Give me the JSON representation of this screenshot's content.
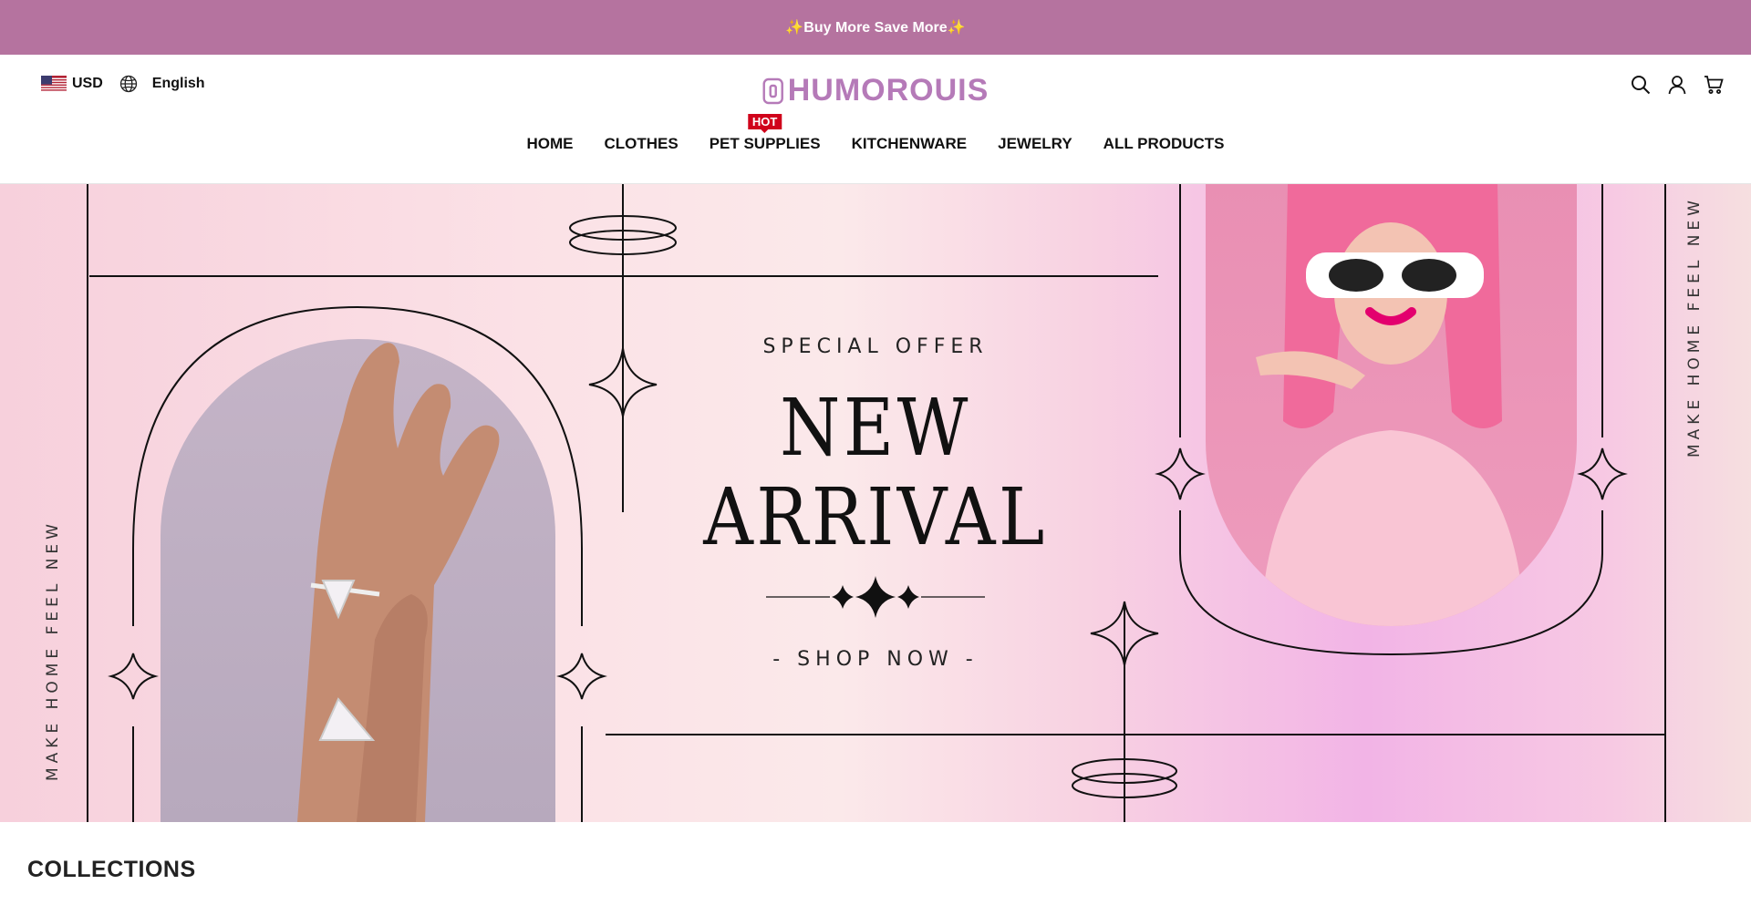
{
  "announcement": {
    "text": "✨Buy More Save More✨"
  },
  "header": {
    "currency": "USD",
    "language": "English",
    "logo": "HUMOROUIS",
    "icons": [
      "search-icon",
      "user-icon",
      "cart-icon"
    ]
  },
  "nav": {
    "items": [
      {
        "label": "HOME"
      },
      {
        "label": "CLOTHES"
      },
      {
        "label": "PET SUPPLIES",
        "badge": "HOT"
      },
      {
        "label": "KITCHENWARE"
      },
      {
        "label": "JEWELRY"
      },
      {
        "label": "ALL PRODUCTS"
      }
    ]
  },
  "hero": {
    "subtitle": "SPECIAL OFFER",
    "title_line1": "NEW",
    "title_line2": "ARRIVAL",
    "cta": "- SHOP NOW -",
    "side_text_left": "MAKE HOME FEEL NEW",
    "side_text_right": "MAKE HOME FEEL NEW"
  },
  "collections": {
    "heading": "COLLECTIONS"
  },
  "colors": {
    "announcement_bg": "#b5739f",
    "logo": "#b57ab8",
    "hot_badge": "#d0021b"
  }
}
